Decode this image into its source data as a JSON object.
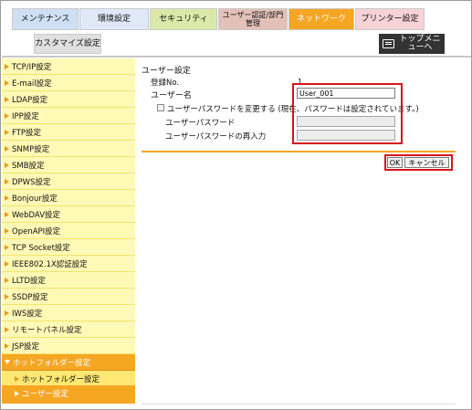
{
  "tabs": [
    {
      "label": "メンテナンス"
    },
    {
      "label": "環境設定"
    },
    {
      "label": "セキュリティ"
    },
    {
      "label": "ユーザー認証/部門管理"
    },
    {
      "label": "ネットワーク"
    },
    {
      "label": "プリンター設定"
    },
    {
      "label": "カスタマイズ設定"
    }
  ],
  "top_menu": {
    "label": "トップメニューへ",
    "icon": "menu-icon"
  },
  "sidebar": {
    "items": [
      {
        "label": "TCP/IP設定"
      },
      {
        "label": "E-mail設定"
      },
      {
        "label": "LDAP設定"
      },
      {
        "label": "IPP設定"
      },
      {
        "label": "FTP設定"
      },
      {
        "label": "SNMP設定"
      },
      {
        "label": "SMB設定"
      },
      {
        "label": "DPWS設定"
      },
      {
        "label": "Bonjour設定"
      },
      {
        "label": "WebDAV設定"
      },
      {
        "label": "OpenAPI設定"
      },
      {
        "label": "TCP Socket設定"
      },
      {
        "label": "IEEE802.1X認証設定"
      },
      {
        "label": "LLTD設定"
      },
      {
        "label": "SSDP設定"
      },
      {
        "label": "IWS設定"
      },
      {
        "label": "リモートパネル設定"
      },
      {
        "label": "JSP設定"
      }
    ],
    "expanded": {
      "label": "ホットフォルダー設定"
    },
    "sub_items": [
      {
        "label": "ホットフォルダー設定"
      },
      {
        "label": "ユーザー設定"
      }
    ]
  },
  "main": {
    "title": "ユーザー設定",
    "reg_no_label": "登録No.",
    "reg_no_value": "1",
    "user_name_label": "ユーザー名",
    "user_name_value": "User_001",
    "change_password_label": "ユーザーパスワードを変更する (現在、パスワードは設定されています。)",
    "password_label": "ユーザーパスワード",
    "password_confirm_label": "ユーザーパスワードの再入力",
    "ok_label": "OK",
    "cancel_label": "キャンセル"
  },
  "colors": {
    "accent": "#f5a623",
    "sidebar_bg": "#fff9b6",
    "highlight_red": "#d6141c"
  }
}
